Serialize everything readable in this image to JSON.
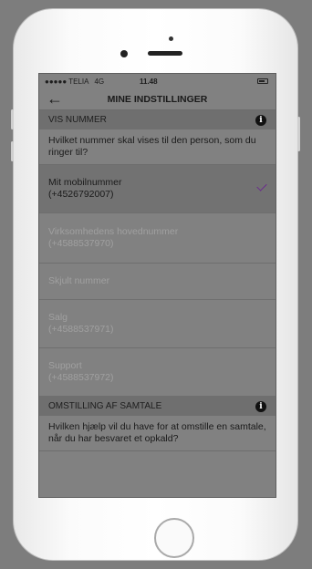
{
  "status_bar": {
    "carrier": "●●●●● TELIA",
    "network": "4G",
    "time": "11.48"
  },
  "nav": {
    "title": "MINE INDSTILLINGER",
    "back_icon": "arrow-left-icon"
  },
  "sections": [
    {
      "header": "VIS NUMMER",
      "info_icon": "i",
      "description": "Hvilket nummer skal vises til den person, som du ringer til?",
      "options": [
        {
          "label": "Mit mobilnummer",
          "sub": "(+4526792007)",
          "selected": true
        },
        {
          "label": "Virksomhedens hovednummer",
          "sub": "(+4588537970)",
          "selected": false
        },
        {
          "label": "Skjult nummer",
          "sub": "",
          "selected": false
        },
        {
          "label": "Salg",
          "sub": "(+4588537971)",
          "selected": false
        },
        {
          "label": "Support",
          "sub": "(+4588537972)",
          "selected": false
        }
      ]
    },
    {
      "header": "OMSTILLING AF SAMTALE",
      "info_icon": "i",
      "description": "Hvilken hjælp vil du have for at omstille en samtale, når du har besvaret et opkald?"
    }
  ],
  "colors": {
    "accent_check": "#6b2b8e"
  }
}
